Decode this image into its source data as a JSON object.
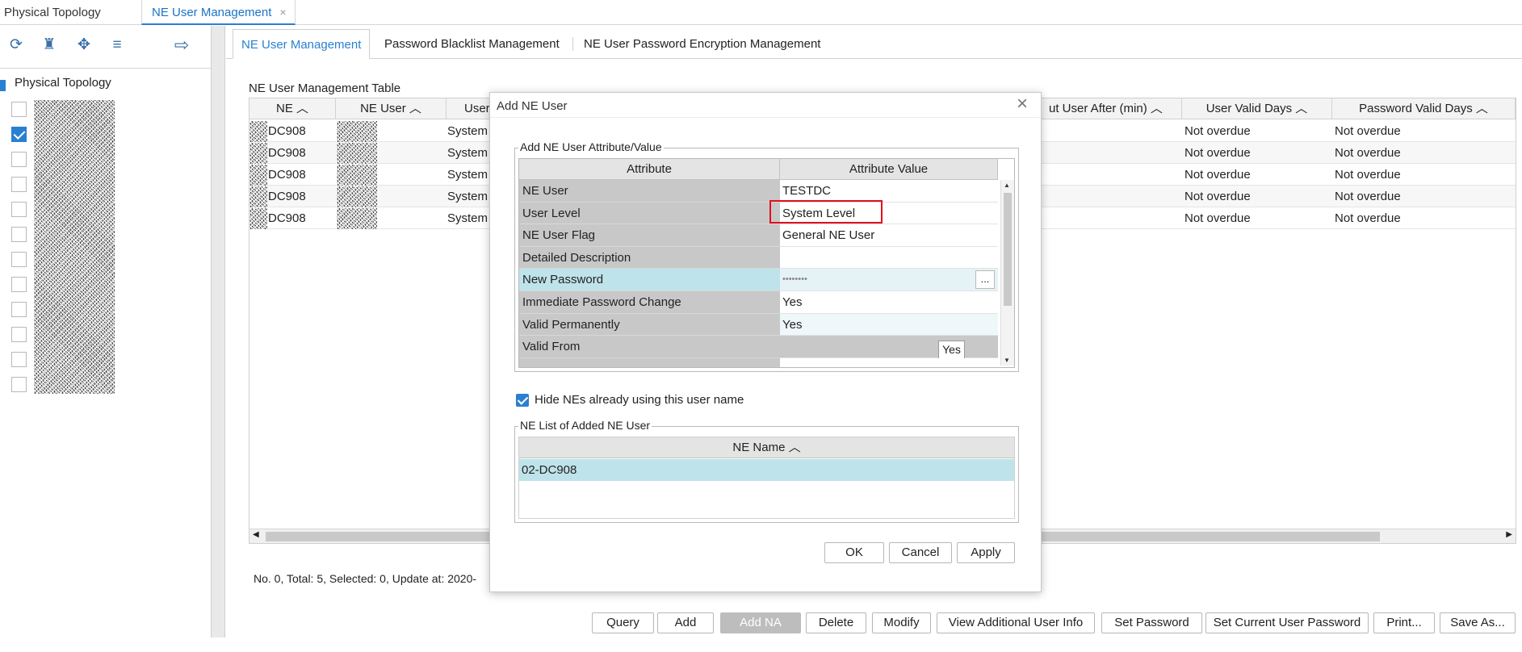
{
  "top_tabs": {
    "tab1": "Physical Topology",
    "tab2": "NE User Management",
    "close_glyph": "×"
  },
  "left_panel": {
    "toolbar_icons": [
      "refresh-icon",
      "binoculars-icon",
      "locate-icon",
      "collapse-icon",
      "arrow-right-icon"
    ],
    "tree_root": "Physical Topology",
    "checkbox_states": [
      false,
      true,
      false,
      false,
      false,
      false,
      false,
      false,
      false,
      false,
      false,
      false
    ]
  },
  "sub_tabs": {
    "tab1": "NE User Management",
    "tab2": "Password Blacklist Management",
    "tab3": "NE User Password Encryption Management"
  },
  "table": {
    "title": "NE User Management Table",
    "headers": {
      "ne": "NE ︿",
      "ne_user": "NE User ︿",
      "user_level": "User",
      "logout_after": "ut User After (min) ︿",
      "valid_days": "User Valid Days ︿",
      "password_valid_days": "Password Valid Days ︿"
    },
    "rows": [
      {
        "ne": "DC908",
        "level": "System",
        "valid": "Not overdue",
        "pwd": "Not overdue"
      },
      {
        "ne": "DC908",
        "level": "System",
        "valid": "Not overdue",
        "pwd": "Not overdue"
      },
      {
        "ne": "DC908",
        "level": "System",
        "valid": "Not overdue",
        "pwd": "Not overdue"
      },
      {
        "ne": "DC908",
        "level": "System",
        "valid": "Not overdue",
        "pwd": "Not overdue"
      },
      {
        "ne": "DC908",
        "level": "System",
        "valid": "Not overdue",
        "pwd": "Not overdue"
      }
    ]
  },
  "status_text": "No. 0, Total: 5, Selected: 0, Update at: 2020-",
  "bottom_buttons": {
    "query": "Query",
    "add": "Add",
    "add_na_user": "Add NA User",
    "delete": "Delete",
    "modify": "Modify",
    "view_info": "View Additional User Info",
    "set_password": "Set Password",
    "set_current": "Set Current User Password",
    "print": "Print...",
    "save_as": "Save As..."
  },
  "dialog": {
    "title": "Add NE User",
    "attr_group_legend": "Add NE User Attribute/Value",
    "attr_header": "Attribute",
    "value_header": "Attribute Value",
    "attributes": [
      {
        "name": "NE User",
        "value": "TESTDC"
      },
      {
        "name": "User Level",
        "value": "System Level"
      },
      {
        "name": "NE User Flag",
        "value": "General NE User"
      },
      {
        "name": "Detailed Description",
        "value": ""
      },
      {
        "name": "New Password",
        "value": "••••••••"
      },
      {
        "name": "Immediate Password Change",
        "value": "Yes"
      },
      {
        "name": "Valid Permanently",
        "value": "Yes"
      },
      {
        "name": "Valid From",
        "value": ""
      }
    ],
    "ellipsis": "...",
    "yes_popup": "Yes",
    "hide_checkbox_label": "Hide NEs already using this user name",
    "ne_list_legend": "NE List of Added NE User",
    "ne_name_header": "NE Name ︿",
    "ne_list": [
      "02-DC908"
    ],
    "ok": "OK",
    "cancel": "Cancel",
    "apply": "Apply"
  },
  "colors": {
    "accent": "#2a80d0",
    "highlight_red": "#e0101a",
    "selected_row": "#bfe3ea"
  }
}
